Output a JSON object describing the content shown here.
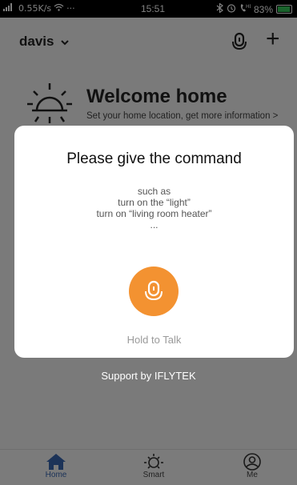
{
  "status_bar": {
    "signal": "4G",
    "speed": "0.55K/s",
    "dots": "···",
    "time": "15:51",
    "battery_percent": "83%",
    "battery_level": 0.83
  },
  "header": {
    "home_name": "davis",
    "home_chevron": "⌄",
    "add_symbol": "+"
  },
  "welcome": {
    "title": "Welcome home",
    "subtitle": "Set your home location, get more information >"
  },
  "dialog": {
    "title": "Please give the command",
    "examples": [
      "such as",
      "turn on the “light”",
      "turn on “living room heater”",
      "..."
    ],
    "hold_label": "Hold to Talk",
    "mic_color": "#f39231"
  },
  "support_text": "Support by IFLYTEK",
  "tabs": [
    {
      "label": "Home",
      "icon": "home-icon",
      "active": true
    },
    {
      "label": "Smart",
      "icon": "sun-icon",
      "active": false
    },
    {
      "label": "Me",
      "icon": "user-icon",
      "active": false
    }
  ],
  "colors": {
    "accent": "#f39231",
    "tab_active": "#3866b0"
  }
}
